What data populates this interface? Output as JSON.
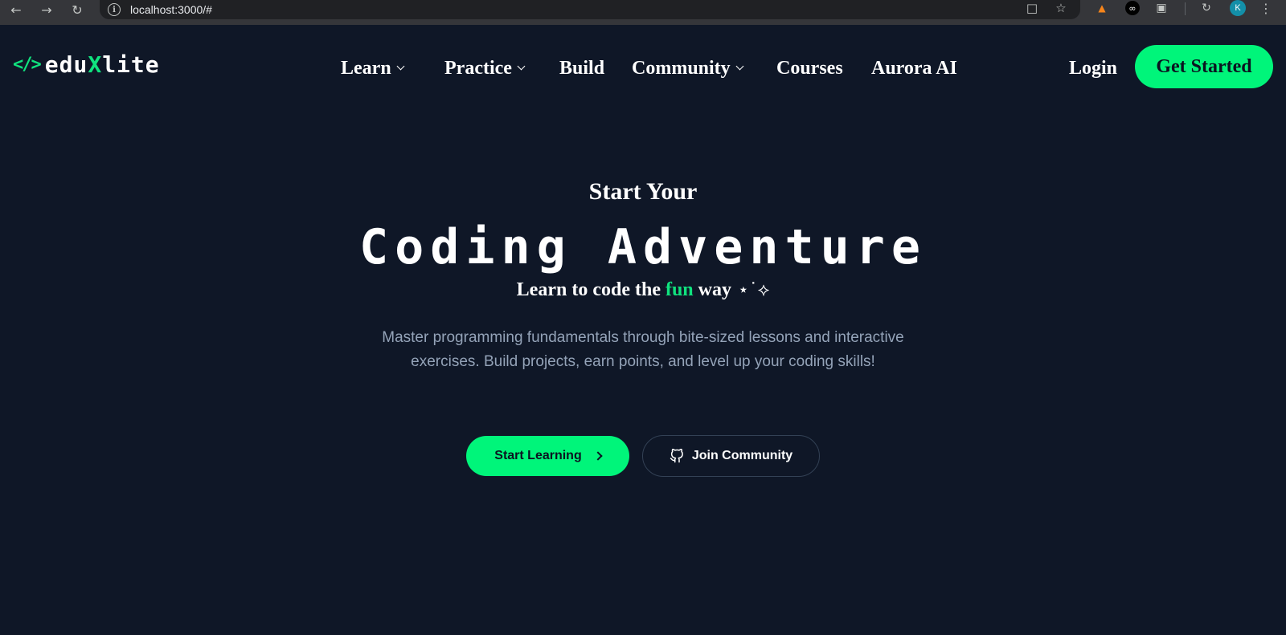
{
  "browser": {
    "url": "localhost:3000/#",
    "back_icon": "arrow-left-icon",
    "forward_icon": "arrow-right-icon",
    "reload_icon": "reload-icon",
    "avatar_letter": "K"
  },
  "nav": {
    "logo": {
      "prefix": "edu",
      "highlight": "X",
      "suffix": "lite",
      "icon": "code-brackets-icon"
    },
    "items": [
      {
        "label": "Learn",
        "has_dropdown": true
      },
      {
        "label": "Practice",
        "has_dropdown": true
      },
      {
        "label": "Build",
        "has_dropdown": false
      },
      {
        "label": "Community",
        "has_dropdown": true
      },
      {
        "label": "Courses",
        "has_dropdown": false
      },
      {
        "label": "Aurora AI",
        "has_dropdown": false
      }
    ],
    "login_label": "Login",
    "cta_label": "Get Started"
  },
  "hero": {
    "kicker": "Start Your",
    "title": "Coding Adventure",
    "subtitle_before": "Learn to code the",
    "subtitle_highlight": "fun",
    "subtitle_after": "way",
    "subtitle_sparkle": "⋆˙⟡",
    "description": "Master programming fundamentals through bite-sized lessons and interactive exercises. Build projects, earn points, and level up your coding skills!",
    "primary_button": "Start Learning",
    "secondary_button": "Join Community"
  },
  "colors": {
    "background": "#0f1727",
    "accent": "#00f57a",
    "muted_text": "#94a3b8"
  }
}
